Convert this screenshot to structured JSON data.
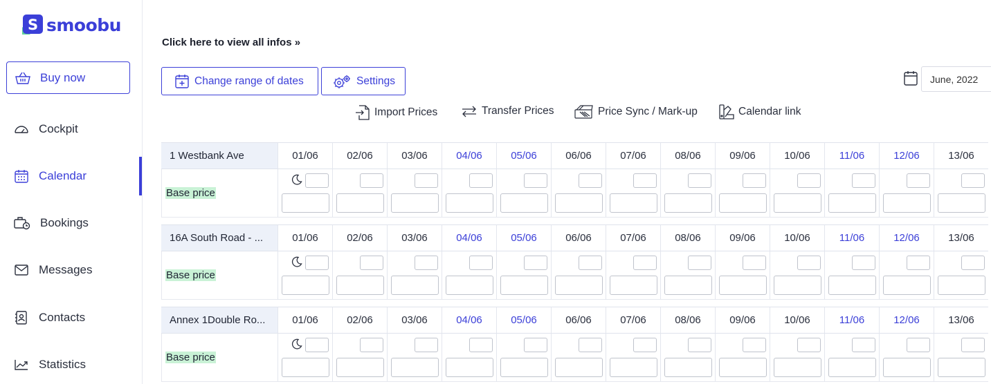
{
  "brand": {
    "name": "smoobu",
    "accent": "#3b3fd8",
    "logo_green": "#5fd39a"
  },
  "sidebar": {
    "buy_now_label": "Buy now",
    "items": [
      {
        "label": "Cockpit",
        "icon": "speedometer-icon",
        "active": false
      },
      {
        "label": "Calendar",
        "icon": "calendar-icon",
        "active": true
      },
      {
        "label": "Bookings",
        "icon": "bookings-icon",
        "active": false
      },
      {
        "label": "Messages",
        "icon": "envelope-icon",
        "active": false
      },
      {
        "label": "Contacts",
        "icon": "contact-card-icon",
        "active": false
      },
      {
        "label": "Statistics",
        "icon": "chart-line-icon",
        "active": false
      }
    ]
  },
  "main": {
    "info_link": "Click here to view all infos »",
    "change_range_label": "Change range of dates",
    "settings_label": "Settings",
    "date_picker_value": "June, 2022",
    "toolbar": {
      "import": "Import Prices",
      "transfer": "Transfer Prices",
      "sync": "Price Sync / Mark-up",
      "calendar_link": "Calendar link"
    },
    "dates": [
      "01/06",
      "02/06",
      "03/06",
      "04/06",
      "05/06",
      "06/06",
      "07/06",
      "08/06",
      "09/06",
      "10/06",
      "11/06",
      "12/06",
      "13/06"
    ],
    "weekend_indices": [
      3,
      4,
      10,
      11
    ],
    "row_label": "Base price",
    "properties": [
      {
        "name": "1 Westbank Ave"
      },
      {
        "name": "16A South Road - ..."
      },
      {
        "name": "Annex 1Double Ro..."
      }
    ]
  }
}
